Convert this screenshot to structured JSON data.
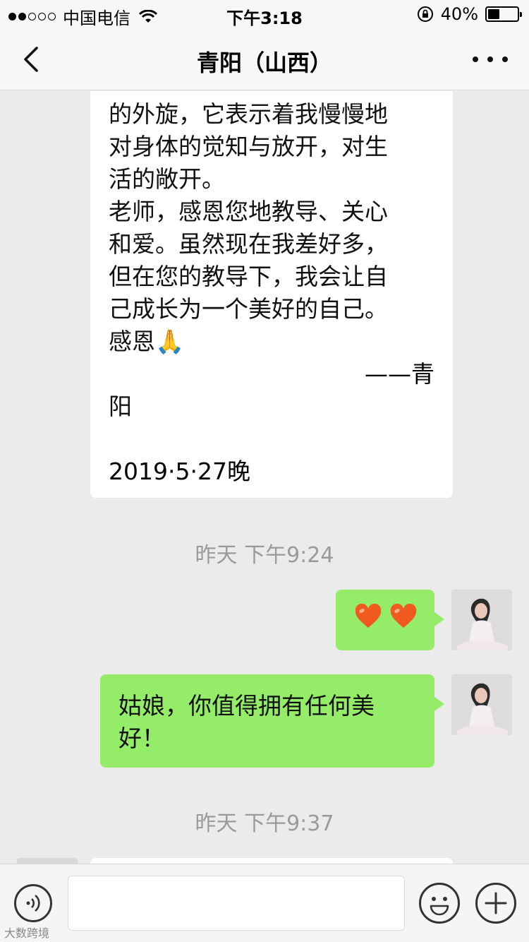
{
  "status_bar": {
    "carrier": "中国电信",
    "time": "下午3:18",
    "battery": "40%",
    "battery_level": 0.4,
    "icons": [
      "signal-dots-icon",
      "wifi-icon",
      "orientation-lock-icon",
      "battery-icon"
    ]
  },
  "nav": {
    "title": "青阳（山西）",
    "back_icon": "chevron-left-icon",
    "more_icon": "more-dots-icon"
  },
  "messages": {
    "incoming_text": "的外旋，它表示着我慢慢地\n对身体的觉知与放开，对生\n活的敞开。\n老师，感恩您地教导、关心\n和爱。虽然现在我差好多，\n但在您的教导下，我会让自\n己成长为一个美好的自己。\n感恩🙏",
    "signature_line1": "——青",
    "signature_line2": "阳",
    "date": "2019·5·27晚",
    "timestamp1": "昨天 下午9:24",
    "hearts": "❤️❤️",
    "outgoing_text": "姑娘，你值得拥有任何美好！",
    "timestamp2": "昨天 下午9:37"
  },
  "input_bar": {
    "placeholder": "",
    "voice_icon": "voice-icon",
    "emoji_icon": "emoji-icon",
    "plus_icon": "plus-icon",
    "watermark": "大数跨境"
  },
  "colors": {
    "green_bubble": "#95ec69",
    "background": "#ebebeb"
  }
}
